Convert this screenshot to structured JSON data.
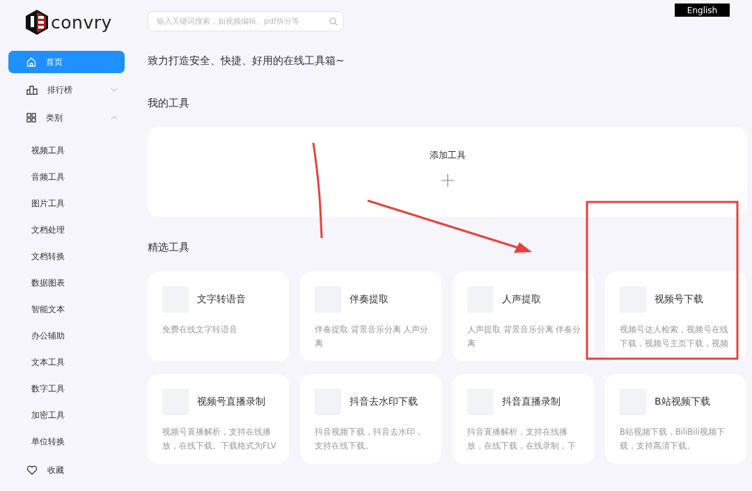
{
  "header": {
    "logo_text": "convry",
    "search": {
      "placeholder": "输入关键词搜索，如视频编辑、pdf拆分等"
    },
    "language_button": "English"
  },
  "sidebar": {
    "items": [
      {
        "label": "首页",
        "selected": true
      },
      {
        "label": "排行榜",
        "selected": false,
        "expanded": false
      },
      {
        "label": "类别",
        "selected": false,
        "expanded": true,
        "children": [
          {
            "label": "视频工具"
          },
          {
            "label": "音频工具"
          },
          {
            "label": "图片工具"
          },
          {
            "label": "文档处理"
          },
          {
            "label": "文档转换"
          },
          {
            "label": "数据图表"
          },
          {
            "label": "智能文本"
          },
          {
            "label": "办公辅助"
          },
          {
            "label": "文本工具"
          },
          {
            "label": "数字工具"
          },
          {
            "label": "加密工具"
          },
          {
            "label": "单位转换"
          }
        ]
      },
      {
        "label": "收藏",
        "selected": false
      }
    ]
  },
  "tagline": "致力打造安全、快捷、好用的在线工具箱~",
  "my_tools": {
    "title": "我的工具",
    "add_label": "添加工具"
  },
  "featured": {
    "title": "精选工具",
    "cards": [
      {
        "title": "文字转语音",
        "description": "免费在线文字转语音"
      },
      {
        "title": "伴奏提取",
        "description": "伴奏提取 背景音乐分离 人声分离"
      },
      {
        "title": "人声提取",
        "description": "人声提取 背景音乐分离 伴奏分离"
      },
      {
        "title": "视频号下载",
        "description": "视频号达人检索，视频号在线下载，视频号主页下载，视频"
      },
      {
        "title": "视频号直播录制",
        "description": "视频号直播解析，支持在线播放，在线下载。下载格式为FLV"
      },
      {
        "title": "抖音去水印下载",
        "description": "抖音视频下载，抖音去水印，支持在线下载。"
      },
      {
        "title": "抖音直播录制",
        "description": "抖音直播解析，支持在线播放，在线下载，在线录制，下"
      },
      {
        "title": "B站视频下载",
        "description": "B站视频下载，BiliBili视频下载，支持高清下载。"
      }
    ]
  }
}
